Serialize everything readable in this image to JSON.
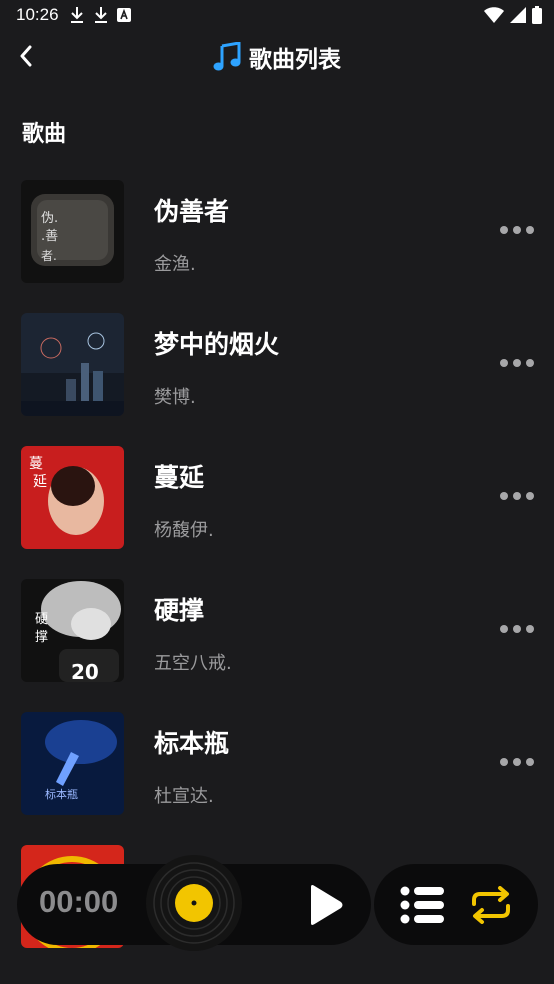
{
  "status_bar": {
    "time": "10:26",
    "left_icons": [
      "download-icon",
      "download-icon",
      "text-a-icon"
    ],
    "right_icons": [
      "wifi-icon",
      "signal-icon",
      "battery-icon"
    ]
  },
  "header": {
    "back_icon": "chevron-left-icon",
    "title_icon": "music-note-icon",
    "title": "歌曲列表"
  },
  "section": {
    "title": "歌曲"
  },
  "songs": [
    {
      "title": "伪善者",
      "artist": "金渔.",
      "cover_color": "#2a2824"
    },
    {
      "title": "梦中的烟火",
      "artist": "樊博.",
      "cover_color": "#2a3444"
    },
    {
      "title": "蔓延",
      "artist": "杨馥伊.",
      "cover_color": "#c81e1e"
    },
    {
      "title": "硬撑",
      "artist": "五空八戒.",
      "cover_color": "#3a3a3a"
    },
    {
      "title": "标本瓶",
      "artist": "杜宣达.",
      "cover_color": "#0e2a5c"
    },
    {
      "title": "",
      "artist": "",
      "cover_color": "#d4261b"
    }
  ],
  "player": {
    "time": "00:00",
    "vinyl_icon": "vinyl-record-icon",
    "play_icon": "play-icon",
    "playlist_icon": "playlist-icon",
    "repeat_icon": "repeat-icon",
    "accent_color": "#f2c500"
  }
}
